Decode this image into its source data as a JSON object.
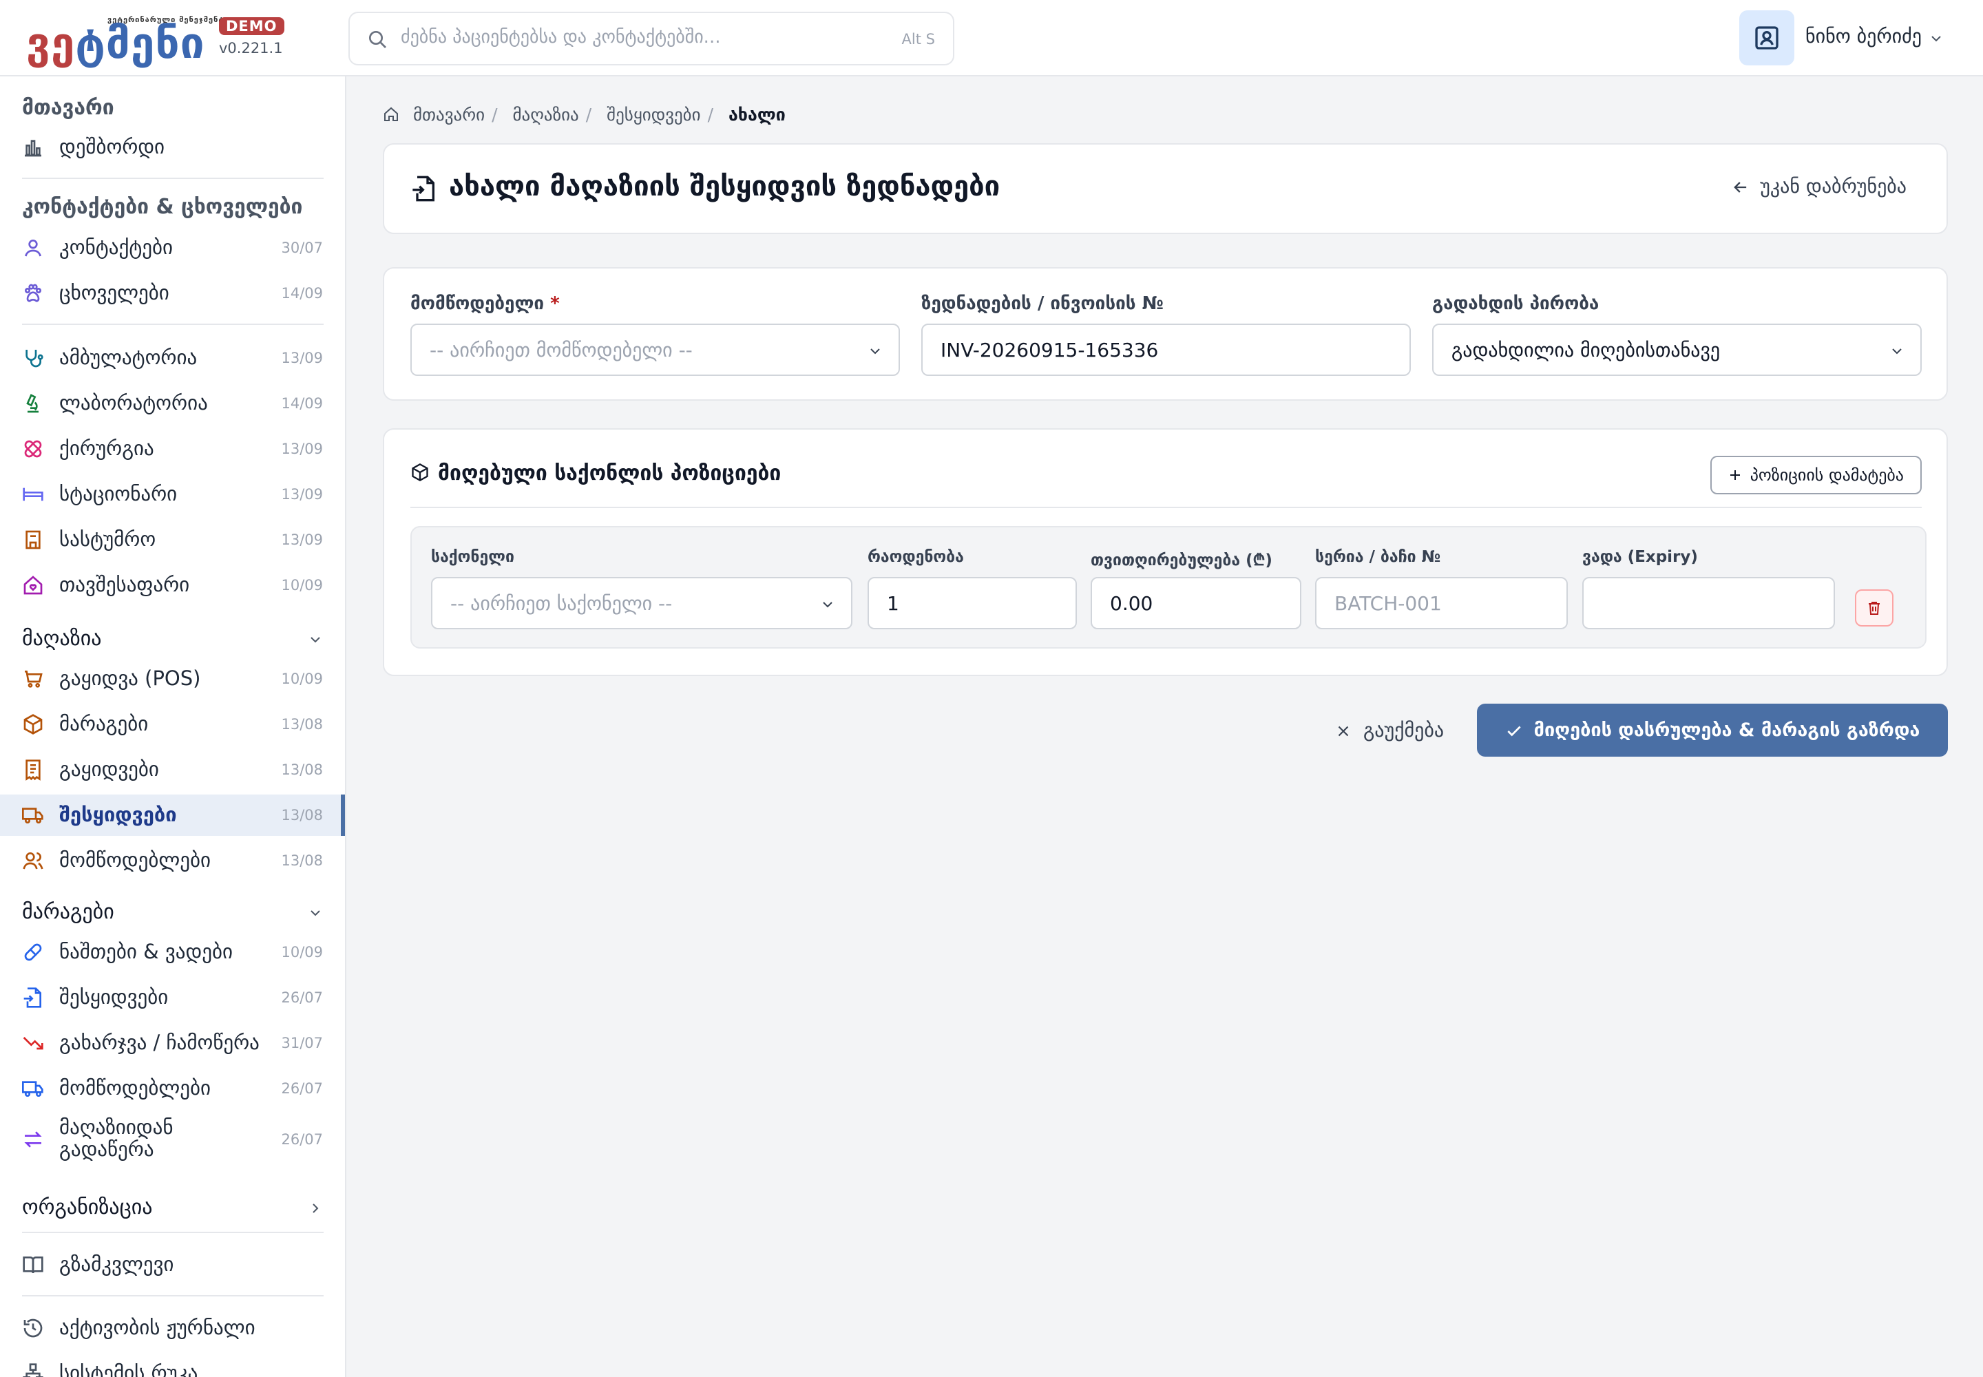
{
  "app": {
    "logo_text": "ვეტმენი",
    "logo_subtitle": "ვეტერინარული მენეჯმენტი",
    "badge": "DEMO",
    "version": "v0.221.1"
  },
  "search": {
    "placeholder": "ძებნა პაციენტებსა და კონტაქტებში...",
    "shortcut": "Alt S"
  },
  "user": {
    "name": "ნინო ბერიძე"
  },
  "sidebar": {
    "main_title": "მთავარი",
    "dashboard": "დეშბორდი",
    "contacts_title": "კონტაქტები & ცხოველები",
    "contacts": {
      "label": "კონტაქტები",
      "date": "30/07"
    },
    "animals": {
      "label": "ცხოველები",
      "date": "14/09"
    },
    "ambulatory": {
      "label": "ამბულატორია",
      "date": "13/09"
    },
    "laboratory": {
      "label": "ლაბორატორია",
      "date": "14/09"
    },
    "surgery": {
      "label": "ქირურგია",
      "date": "13/09"
    },
    "stationary": {
      "label": "სტაციონარი",
      "date": "13/09"
    },
    "hotel": {
      "label": "სასტუმრო",
      "date": "13/09"
    },
    "shelter": {
      "label": "თავშესაფარი",
      "date": "10/09"
    },
    "shop_title": "მაღაზია",
    "pos": {
      "label": "გაყიდვა (POS)",
      "date": "10/09"
    },
    "shop_stock": {
      "label": "მარაგები",
      "date": "13/08"
    },
    "sales": {
      "label": "გაყიდვები",
      "date": "13/08"
    },
    "shop_purchases": {
      "label": "შესყიდვები",
      "date": "13/08"
    },
    "shop_suppliers": {
      "label": "მომწოდებლები",
      "date": "13/08"
    },
    "stock_title": "მარაგები",
    "remains": {
      "label": "ნაშთები & ვადები",
      "date": "10/09"
    },
    "stock_purchases": {
      "label": "შესყიდვები",
      "date": "26/07"
    },
    "writeoff": {
      "label": "გახარჯვა / ჩამოწერა",
      "date": "31/07"
    },
    "stock_suppliers": {
      "label": "მომწოდებლები",
      "date": "26/07"
    },
    "transfer": {
      "label": "მაღაზიიდან გადაწერა",
      "date": "26/07"
    },
    "org_title": "ორგანიზაცია",
    "guide": "გზამკვლევი",
    "activity": "აქტივობის ჟურნალი",
    "sitemap": "სისტემის რუკა"
  },
  "breadcrumb": [
    "მთავარი",
    "მაღაზია",
    "შესყიდვები",
    "ახალი"
  ],
  "page": {
    "title": "ახალი მაღაზიის შესყიდვის ზედნადები",
    "back": "უკან დაბრუნება"
  },
  "form": {
    "supplier_label": "მომწოდებელი",
    "required_mark": "*",
    "supplier_placeholder": "-- აირჩიეთ მომწოდებელი --",
    "invoice_label": "ზედნადების / ინვოისის №",
    "invoice_value": "INV-20260915-165336",
    "payment_label": "გადახდის პირობა",
    "payment_value": "გადახდილია მიღებისთანავე"
  },
  "items": {
    "title": "მიღებული საქონლის პოზიციები",
    "add_button": "პოზიციის დამატება",
    "col_product": "საქონელი",
    "col_qty": "რაოდენობა",
    "col_cost": "თვითღირებულება (₾)",
    "col_batch": "სერია / ბაჩი №",
    "col_expiry": "ვადა (Expiry)",
    "product_placeholder": "-- აირჩიეთ საქონელი --",
    "qty_value": "1",
    "cost_value": "0.00",
    "batch_placeholder": "BATCH-001"
  },
  "actions": {
    "cancel": "გაუქმება",
    "submit": "მიღების დასრულება & მარაგის გაზრდა"
  },
  "colors": {
    "primary": "#4a6fa5",
    "brand_red": "#b94040",
    "brand_blue": "#3b67b0"
  }
}
